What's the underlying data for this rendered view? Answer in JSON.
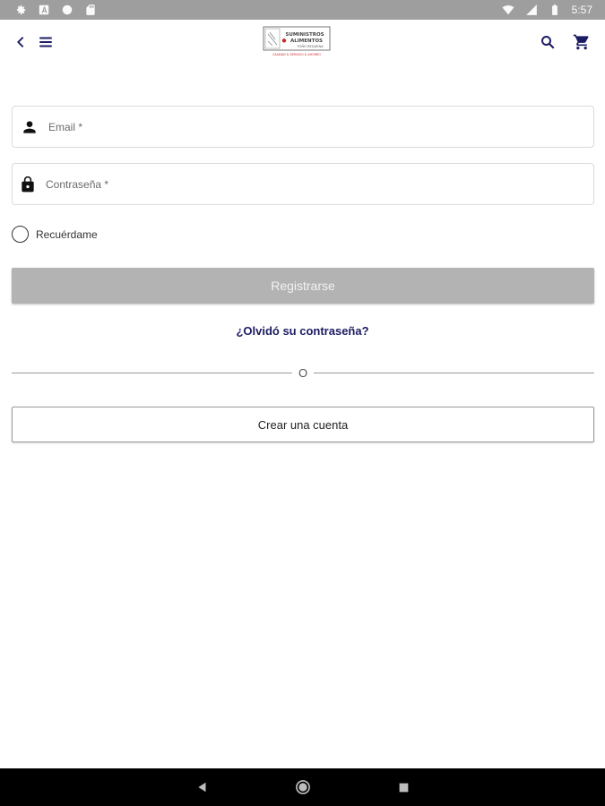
{
  "status_bar": {
    "time": "5:57",
    "left_icons": [
      "gear-icon",
      "a-badge-icon",
      "circle-icon",
      "sd-card-icon"
    ],
    "right_icons": [
      "wifi-icon",
      "signal-icon",
      "battery-icon"
    ]
  },
  "app_bar": {
    "logo_text_line1": "SUMINISTROS",
    "logo_text_line2": "ALIMENTOS",
    "logo_subtext": "TOÑO REQUENA",
    "logo_tagline": "CALIDAD & SERVICIO & AHORRO"
  },
  "form": {
    "email_label": "Email *",
    "password_label": "Contraseña *",
    "remember_label": "Recuérdame",
    "register_button": "Registrarse",
    "forgot_link": "¿Olvidó su contraseña?",
    "divider_text": "O",
    "create_account_button": "Crear una cuenta"
  },
  "colors": {
    "status_bar": "#9e9e9e",
    "accent": "#1c1c63",
    "button_disabled": "#b3b3b3",
    "logo_red": "#c62828"
  }
}
